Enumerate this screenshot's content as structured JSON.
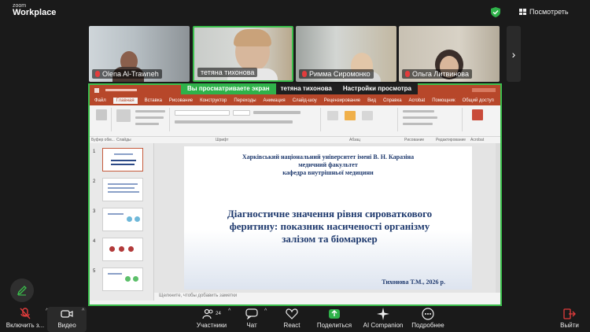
{
  "app": {
    "brand_line1": "zoom",
    "brand_line2": "Workplace",
    "view_label": "Посмотреть"
  },
  "participants": [
    {
      "name": "Olena Al-Trawneh"
    },
    {
      "name": "тетяна тихонова"
    },
    {
      "name": "Римма Сиромонко"
    },
    {
      "name": "Ольга Литвинова"
    }
  ],
  "share": {
    "viewing_label": "Вы просматриваете экран",
    "presenter": "тетяна тихонова",
    "view_settings": "Настройки просмотра"
  },
  "ppt": {
    "tabs": [
      "Файл",
      "Главная",
      "Вставка",
      "Рисование",
      "Конструктор",
      "Переходы",
      "Анимация",
      "Слайд-шоу",
      "Рецензирование",
      "Вид",
      "Справка",
      "Acrobat",
      "Помощник",
      "Общий доступ"
    ],
    "active_tab": "Главная",
    "ribbon_groups": [
      "Буфер обм...",
      "Слайды",
      "Шрифт",
      "Абзац",
      "Рисование",
      "Редактирование",
      "Acrobat"
    ],
    "slide_numbers": [
      "1",
      "2",
      "3",
      "4",
      "5"
    ],
    "slide": {
      "university_line1": "Харківський національний університет  імені В. Н. Каразіна",
      "university_line2": "медичний факультет",
      "university_line3": "кафедра внутрішньої медицини",
      "title": "Діагностичне значення рівня сироваткового феритину: показник насиченості організму залізом та біомаркер",
      "author": "Тихонова Т.М., 2026 р."
    },
    "notes_placeholder": "Щелкните, чтобы добавить заметки"
  },
  "toolbar": {
    "mute": "Включить з...",
    "video": "Видео",
    "participants": "Участники",
    "participants_count": "24",
    "chat": "Чат",
    "react": "React",
    "share": "Поделиться",
    "ai": "AI Companion",
    "more": "Подробнее",
    "leave": "Выйти"
  }
}
